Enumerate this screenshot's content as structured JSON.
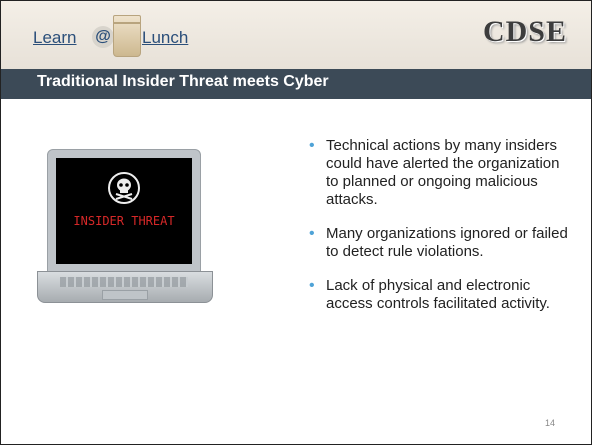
{
  "header": {
    "logo": {
      "word1": "Learn",
      "at": "@",
      "word2": "Lunch"
    },
    "brand": "CDSE"
  },
  "slide": {
    "title": "Traditional Insider Threat meets Cyber",
    "image": {
      "screen_text": "INSIDER THREAT",
      "icon": "skull-crossbones-icon"
    },
    "bullets": [
      "Technical actions by many insiders could have alerted the organization to planned or ongoing malicious attacks.",
      "Many organizations ignored or failed to detect rule violations.",
      "Lack of physical and electronic access controls facilitated activity."
    ],
    "page_number": "14"
  },
  "colors": {
    "title_bar": "#3c4a57",
    "bullet": "#4fa3d7",
    "screen_text": "#d62828",
    "logo_text": "#2b4f7a"
  }
}
